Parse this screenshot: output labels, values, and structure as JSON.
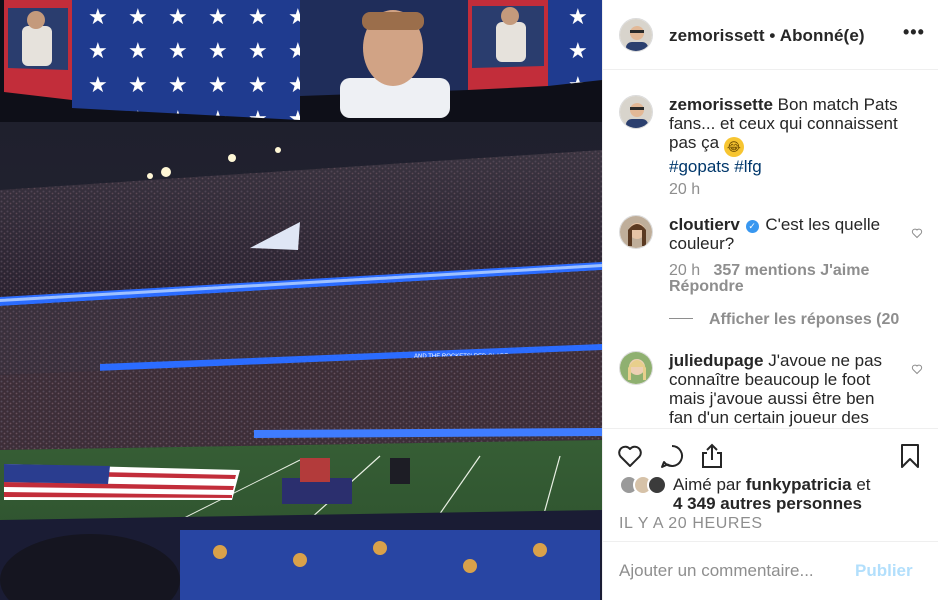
{
  "header": {
    "username": "zemorissett",
    "separator": "•",
    "follow_status": "Abonné(e)",
    "more_label": "•••"
  },
  "comments": [
    {
      "username": "zemorissette",
      "text": "Bon match Pats fans... et ceux qui connaissent pas ça",
      "emoji": "😂",
      "hashtags": [
        "#gopats",
        "#lfg"
      ],
      "time": "20 h"
    },
    {
      "username": "cloutierv",
      "verified": true,
      "text": "C'est les quelle couleur?",
      "time": "20 h",
      "likes": "357 mentions J'aime",
      "reply_label": "Répondre",
      "view_replies": "Afficher les réponses (20"
    },
    {
      "username": "juliedupage",
      "text": "J'avoue ne pas connaître beaucoup le foot mais j'avoue aussi être ben fan d'un certain joueur des Pats"
    }
  ],
  "actions": {
    "liked_by_prefix": "Aimé par",
    "liked_by_user": "funkypatricia",
    "liked_by_and": "et",
    "others": "4 349 autres personnes",
    "timestamp": "IL Y A 20 HEURES"
  },
  "add_comment": {
    "placeholder": "Ajouter un commentaire...",
    "publish_label": "Publier"
  },
  "colors": {
    "link": "#00376b",
    "muted": "#8e8e8e",
    "publish_disabled": "#b2dffc",
    "verified": "#3897f0",
    "stadium_blue": "#2b6cff",
    "field_green": "#3f6b3a"
  },
  "image": {
    "screen_text": "AND THE ROCKETS' RED GLARE"
  }
}
